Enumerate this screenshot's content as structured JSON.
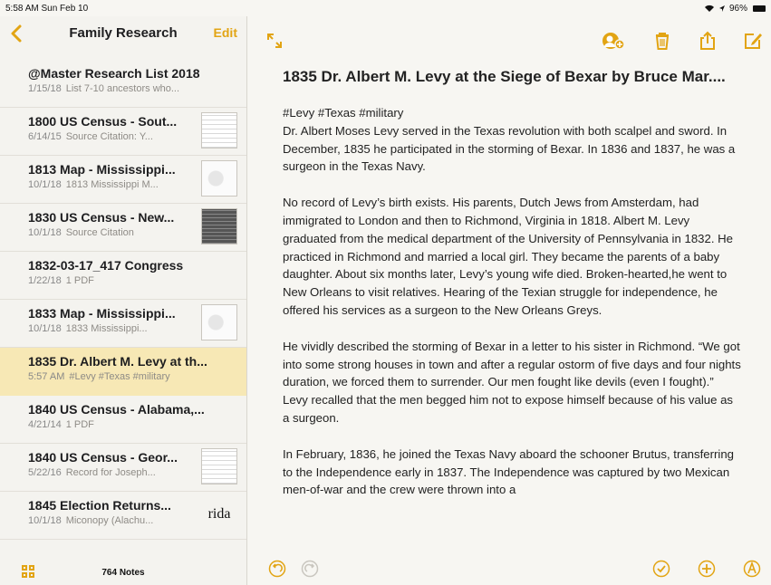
{
  "status": {
    "time_date": "5:58 AM  Sun Feb 10",
    "battery": "96%"
  },
  "sidebar": {
    "title": "Family Research",
    "edit_label": "Edit",
    "count": "764 Notes",
    "notes": [
      {
        "title": "@Master Research List 2018",
        "date": "1/15/18",
        "snippet": "List 7-10 ancestors who...",
        "thumb": "none"
      },
      {
        "title": "1800 US Census - Sout...",
        "date": "6/14/15",
        "snippet": "Source Citation: Y...",
        "thumb": "lines"
      },
      {
        "title": "1813 Map - Mississippi...",
        "date": "10/1/18",
        "snippet": "1813 Mississippi M...",
        "thumb": "map"
      },
      {
        "title": "1830 US Census - New...",
        "date": "10/1/18",
        "snippet": "Source Citation",
        "thumb": "dark"
      },
      {
        "title": "1832-03-17_417 Congress",
        "date": "1/22/18",
        "snippet": "1 PDF",
        "thumb": "none"
      },
      {
        "title": "1833 Map - Mississippi...",
        "date": "10/1/18",
        "snippet": "1833 Mississippi...",
        "thumb": "map"
      },
      {
        "title": "1835 Dr. Albert M. Levy at th...",
        "date": "5:57 AM",
        "snippet": "#Levy #Texas #military",
        "thumb": "none"
      },
      {
        "title": "1840 US Census - Alabama,...",
        "date": "4/21/14",
        "snippet": "1 PDF",
        "thumb": "none"
      },
      {
        "title": "1840 US Census - Geor...",
        "date": "5/22/16",
        "snippet": "Record for Joseph...",
        "thumb": "lines"
      },
      {
        "title": "1845 Election Returns...",
        "date": "10/1/18",
        "snippet": "Miconopy (Alachu...",
        "thumb": "rida",
        "thumb_text": "rida"
      }
    ],
    "selected_index": 6
  },
  "note": {
    "title": "1835 Dr. Albert M. Levy at the Siege of Bexar by Bruce Mar....",
    "tags": "#Levy #Texas #military",
    "p1": "Dr. Albert Moses Levy served in the Texas revolution with both scalpel and sword. In December, 1835 he participated in the storming of Bexar. In 1836 and 1837, he was a surgeon in the Texas Navy.",
    "p2": "No record of Levy’s birth exists. His parents, Dutch Jews from Amsterdam, had immigrated to London and then to Richmond, Virginia in 1818. Albert M. Levy graduated from the medical department of the University of Pennsylvania in 1832. He practiced in Richmond and married a local girl. They became the parents of a baby daughter. About six months later, Levy’s young wife died. Broken-hearted,he went to New Orleans to visit relatives. Hearing of the Texian struggle for independence, he offered his services as a surgeon to the New Orleans Greys.",
    "p3": "He vividly described the storming of Bexar in a letter to his sister in Richmond. “We got into some strong houses in town and after a regular ostorm of five days and four nights duration, we forced them to surrender. Our men fought like devils (even I fought).” Levy recalled that the men begged him not to expose himself because of his value as a surgeon.",
    "p4": "In February, 1836, he joined the Texas Navy aboard the schooner Brutus, transferring to the Independence early in 1837. The Independence was captured by two Mexican men-of-war and the crew were thrown into a"
  },
  "colors": {
    "accent": "#e2a413",
    "selected": "#f7e8b5"
  },
  "icons": [
    "back-chevron-icon",
    "expand-icon",
    "add-people-icon",
    "trash-icon",
    "share-icon",
    "compose-icon",
    "grid-icon",
    "undo-icon",
    "redo-icon",
    "checklist-icon",
    "add-icon",
    "markup-icon"
  ]
}
